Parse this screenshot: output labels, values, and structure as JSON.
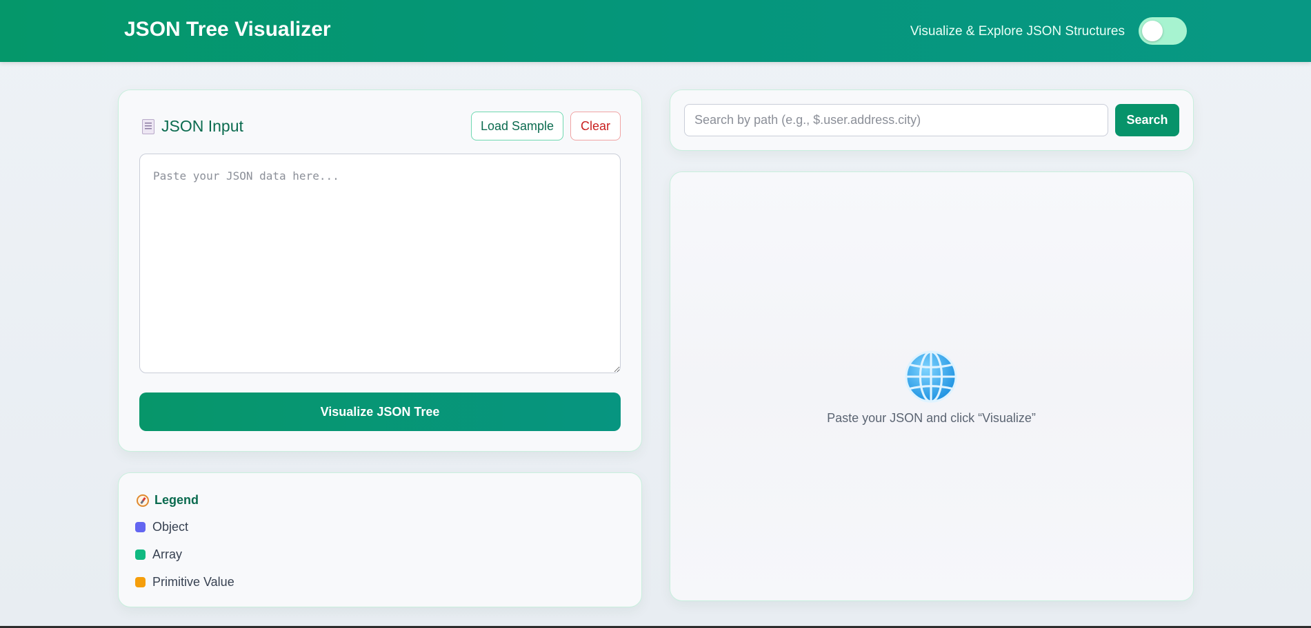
{
  "header": {
    "title": "JSON Tree Visualizer",
    "tagline": "Visualize & Explore JSON Structures",
    "theme_toggle": {
      "icon": "toggle-switch",
      "state": "off"
    }
  },
  "input_panel": {
    "title": "JSON Input",
    "title_icon": "document-icon",
    "load_sample_label": "Load Sample",
    "clear_label": "Clear",
    "textarea": {
      "value": "",
      "placeholder": "Paste your JSON data here..."
    },
    "visualize_label": "Visualize JSON Tree"
  },
  "legend": {
    "title": "Legend",
    "title_icon": "compass-icon",
    "items": [
      {
        "label": "Object",
        "color": "#6366f1"
      },
      {
        "label": "Array",
        "color": "#10b981"
      },
      {
        "label": "Primitive Value",
        "color": "#f59e0b"
      }
    ]
  },
  "search": {
    "placeholder": "Search by path (e.g., $.user.address.city)",
    "value": "",
    "button_label": "Search"
  },
  "tree_view": {
    "empty_icon": "globe-icon",
    "empty_message": "Paste your JSON and click “Visualize”"
  },
  "colors": {
    "brand": "#05976a",
    "accent_light": "#a7f3d0",
    "danger": "#c81e1e"
  }
}
